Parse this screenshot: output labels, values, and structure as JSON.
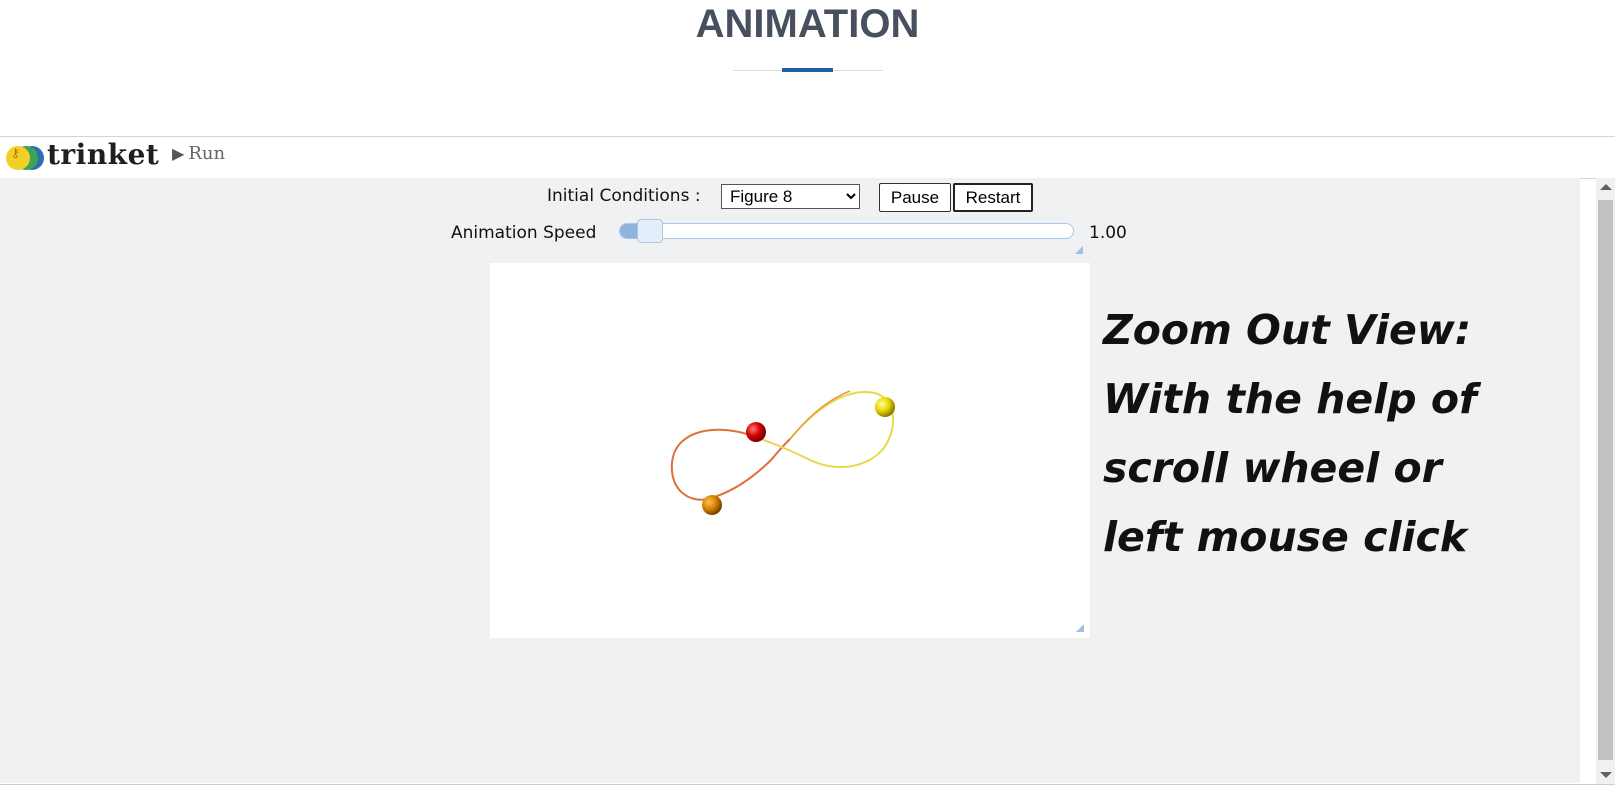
{
  "header": {
    "title": "ANIMATION"
  },
  "trinket": {
    "logo_text": "trinket",
    "run_label": "Run"
  },
  "controls": {
    "initial_conditions_label": "Initial Conditions :",
    "initial_conditions_selected": "Figure 8",
    "pause_label": "Pause",
    "restart_label": "Restart",
    "animation_speed_label": "Animation Speed",
    "animation_speed_value": "1.00",
    "animation_speed_fraction": 0.06
  },
  "note": {
    "lines": [
      "Zoom Out View:",
      "With the help of",
      "scroll wheel or",
      "left mouse click"
    ]
  },
  "scene": {
    "bodies": [
      {
        "name": "red-ball",
        "color": "#d10000"
      },
      {
        "name": "yellow-ball",
        "color": "#e8d600"
      },
      {
        "name": "orange-ball",
        "color": "#d98200"
      }
    ],
    "trail_colors": [
      "#e0703a",
      "#e8d84a"
    ]
  },
  "colors": {
    "title": "#47505e",
    "accent": "#1f5fa6",
    "content_bg": "#f0f1f3"
  }
}
